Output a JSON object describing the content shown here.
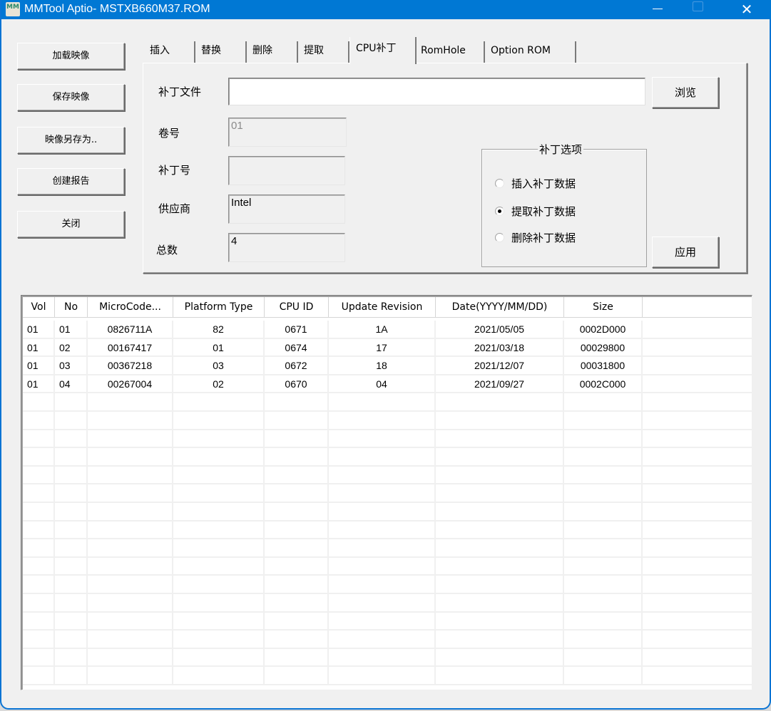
{
  "window": {
    "title": "MMTool Aptio- MSTXB660M37.ROM",
    "app_icon_text": "MM",
    "controls": {
      "minimize": "—",
      "maximize": "",
      "close": "✕"
    }
  },
  "sidebar": {
    "buttons": [
      {
        "id": "load",
        "label": "加载映像"
      },
      {
        "id": "save",
        "label": "保存映像"
      },
      {
        "id": "save_as",
        "label": "映像另存为.."
      },
      {
        "id": "report",
        "label": "创建报告"
      },
      {
        "id": "close",
        "label": "关闭"
      }
    ]
  },
  "tabs": [
    {
      "label": "插入",
      "active": false
    },
    {
      "label": "替换",
      "active": false
    },
    {
      "label": "删除",
      "active": false
    },
    {
      "label": "提取",
      "active": false
    },
    {
      "label": "CPU补丁",
      "active": true
    },
    {
      "label": "RomHole",
      "active": false
    },
    {
      "label": "Option ROM",
      "active": false
    }
  ],
  "patch_panel": {
    "patch_file_label": "补丁文件",
    "patch_file_value": "",
    "browse_label": "浏览",
    "volume_label": "卷号",
    "volume_value": "01",
    "patch_no_label": "补丁号",
    "patch_no_value": "",
    "vendor_label": "供应商",
    "vendor_value": "Intel",
    "total_label": "总数",
    "total_value": "4",
    "options": {
      "title": "补丁选项",
      "items": [
        {
          "label": "插入补丁数据",
          "checked": false
        },
        {
          "label": "提取补丁数据",
          "checked": true
        },
        {
          "label": "删除补丁数据",
          "checked": false
        }
      ]
    },
    "apply_label": "应用"
  },
  "table": {
    "columns": [
      "Vol",
      "No",
      "MicroCode...",
      "Platform Type",
      "CPU ID",
      "Update Revision",
      "Date(YYYY/MM/DD)",
      "Size"
    ],
    "rows": [
      [
        "01",
        "01",
        "0826711A",
        "82",
        "0671",
        "1A",
        "2021/05/05",
        "0002D000"
      ],
      [
        "01",
        "02",
        "00167417",
        "01",
        "0674",
        "17",
        "2021/03/18",
        "00029800"
      ],
      [
        "01",
        "03",
        "00367218",
        "03",
        "0672",
        "18",
        "2021/12/07",
        "00031800"
      ],
      [
        "01",
        "04",
        "00267004",
        "02",
        "0670",
        "04",
        "2021/09/27",
        "0002C000"
      ]
    ]
  }
}
